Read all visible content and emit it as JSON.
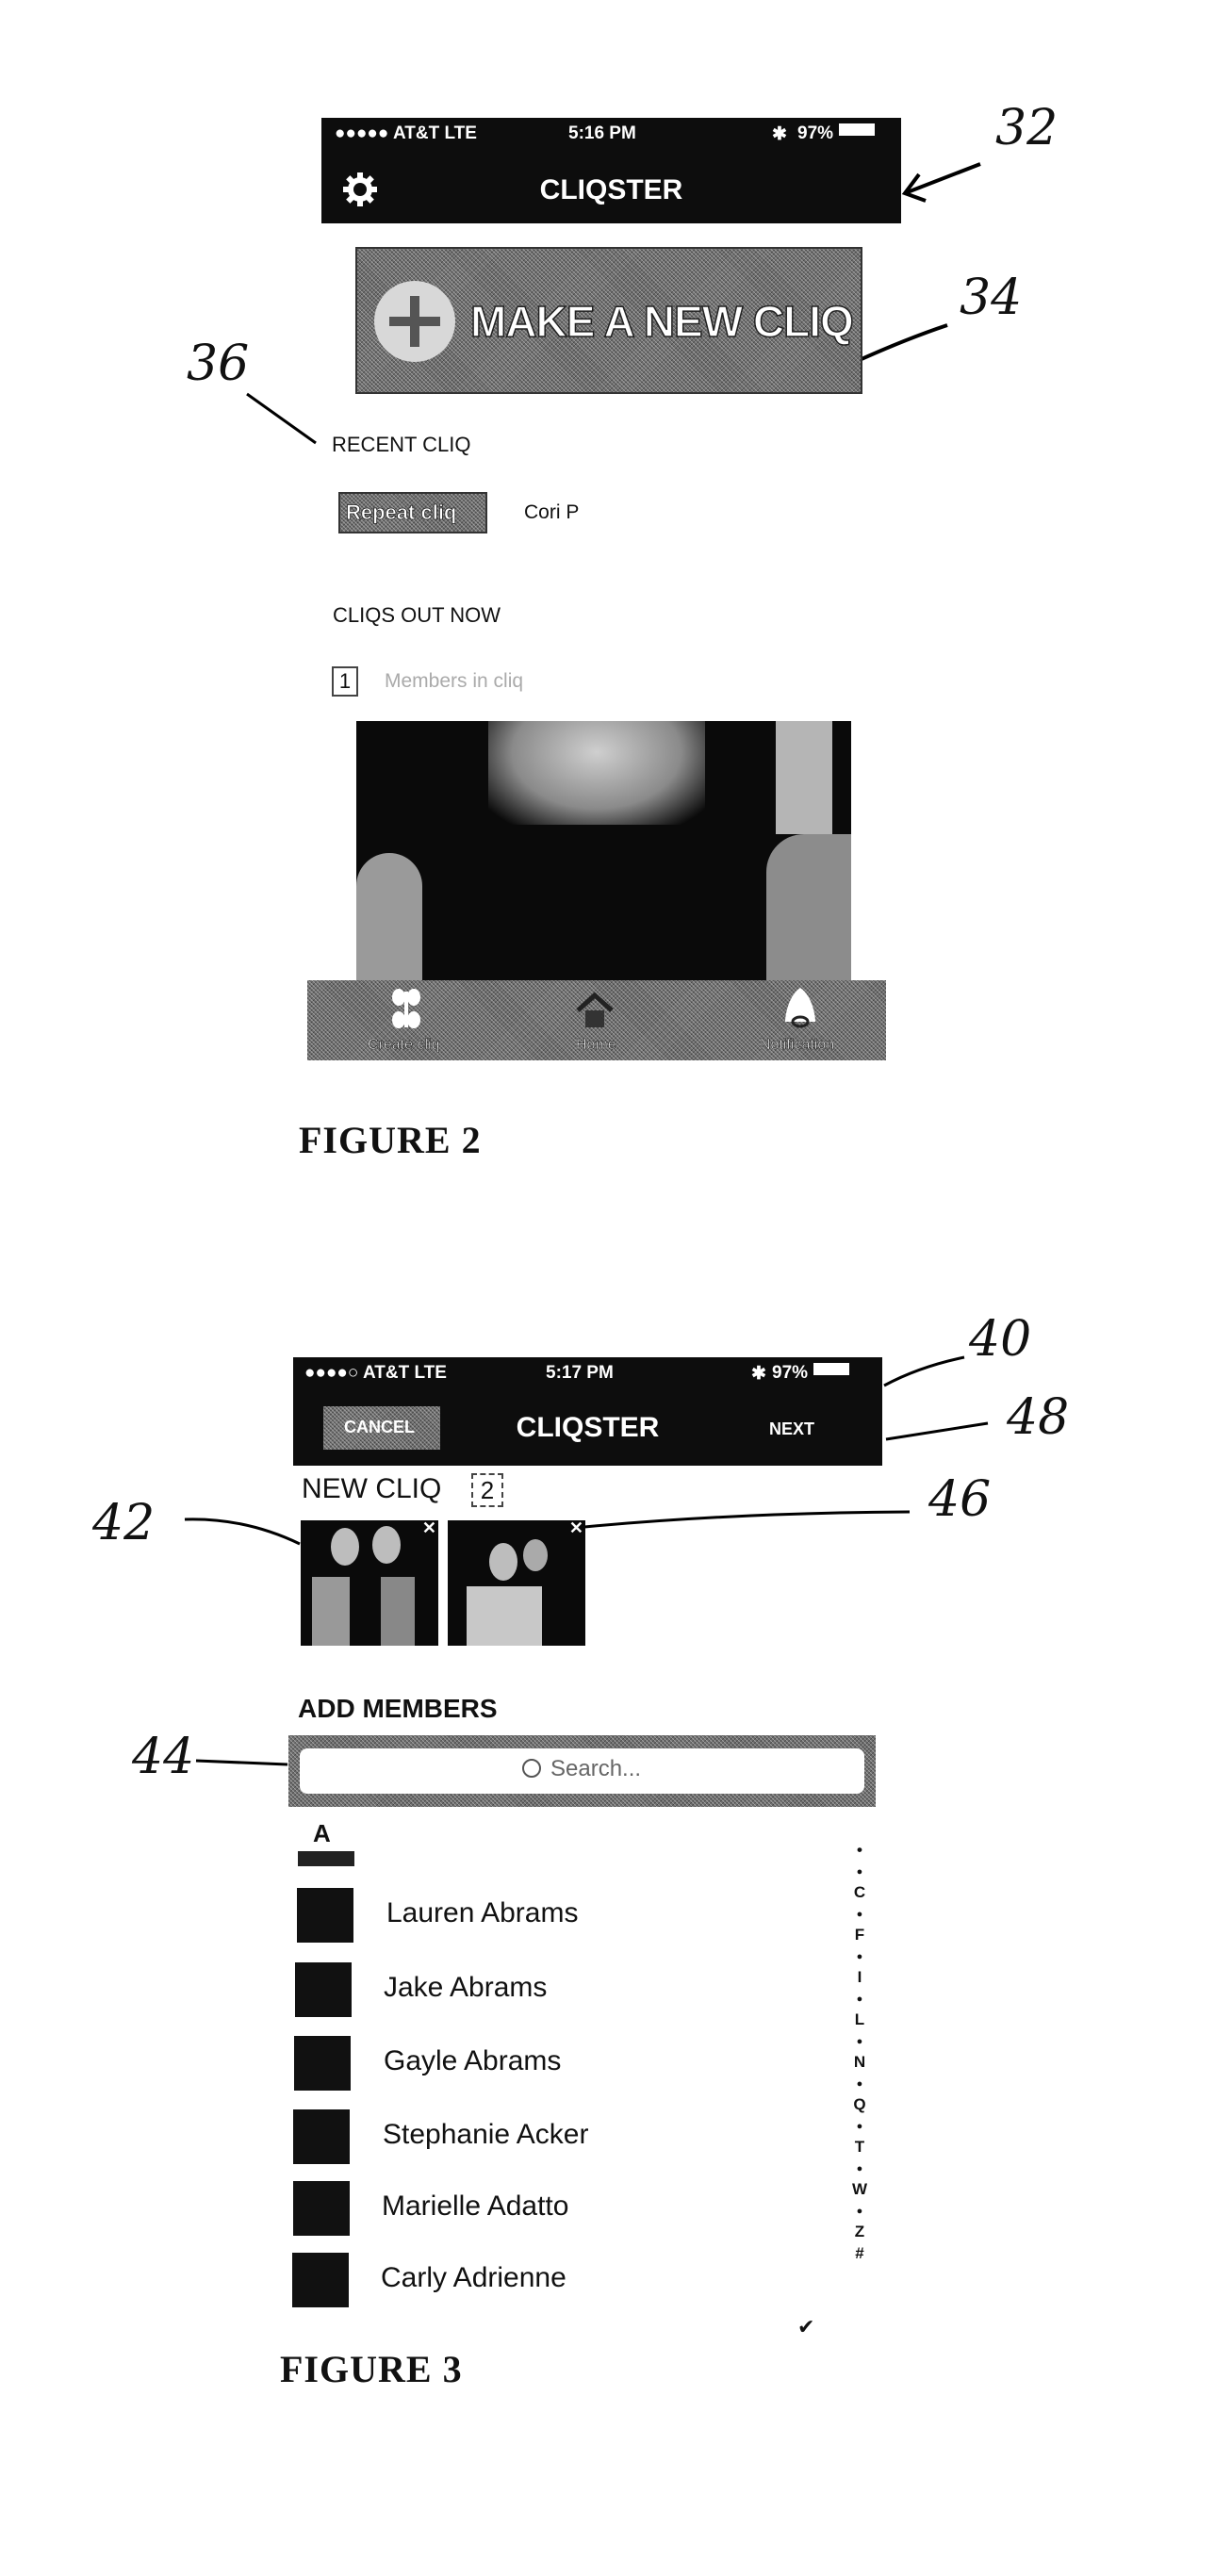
{
  "figure2": {
    "label": "FIGURE 2",
    "status_bar": {
      "carrier": "●●●●● AT&T  LTE",
      "time": "5:16 PM",
      "bluetooth": "✱",
      "battery": "97%"
    },
    "nav": {
      "title": "CLIQSTER",
      "left_icon": "gear-icon"
    },
    "make_new_cliq": {
      "label": "MAKE A NEW CLIQ",
      "icon": "plus-icon"
    },
    "recent_cliq": {
      "heading": "RECENT CLIQ",
      "repeat_button": "Repeat cliq",
      "member": "Cori P"
    },
    "cliqs_out_now": {
      "heading": "CLIQS OUT NOW",
      "count": "1",
      "count_label": "Members in cliq"
    },
    "tab_bar": [
      {
        "label": "Create cliq",
        "icon": "flower-icon"
      },
      {
        "label": "Home",
        "icon": "home-icon"
      },
      {
        "label": "Notification",
        "icon": "bell-icon"
      }
    ],
    "annotations": {
      "header": "32",
      "make_button": "34",
      "recent": "36"
    }
  },
  "figure3": {
    "label": "FIGURE 3",
    "status_bar": {
      "carrier": "●●●●○ AT&T  LTE",
      "time": "5:17 PM",
      "bluetooth": "✱",
      "battery": "97%"
    },
    "nav": {
      "cancel": "CANCEL",
      "title": "CLIQSTER",
      "next": "NEXT"
    },
    "new_cliq": {
      "heading": "NEW CLIQ",
      "count": "2",
      "remove_glyph": "✕"
    },
    "add_members": {
      "heading": "ADD MEMBERS",
      "search_placeholder": "Search...",
      "section_letter": "A"
    },
    "members": [
      {
        "name": "Lauren Abrams"
      },
      {
        "name": "Jake Abrams"
      },
      {
        "name": "Gayle Abrams"
      },
      {
        "name": "Stephanie Acker"
      },
      {
        "name": "Marielle Adatto"
      },
      {
        "name": "Carly Adrienne"
      }
    ],
    "index": [
      "•",
      "●",
      "C",
      "●",
      "F",
      "●",
      "I",
      "●",
      "L",
      "●",
      "N",
      "●",
      "Q",
      "●",
      "T",
      "●",
      "W",
      "●",
      "Z",
      "#"
    ],
    "annotations": {
      "status": "40",
      "nav": "48",
      "remove": "46",
      "thumbs": "42",
      "search": "44"
    }
  }
}
